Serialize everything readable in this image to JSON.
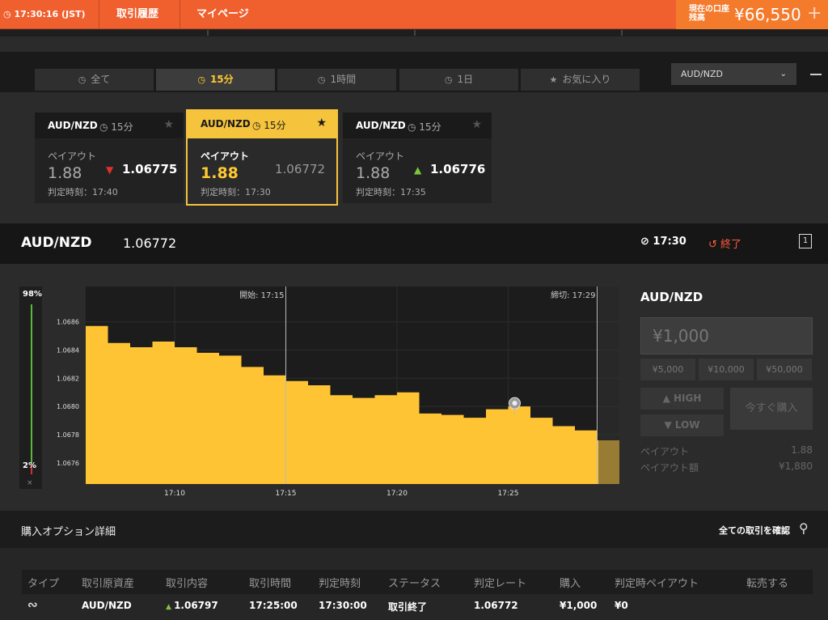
{
  "topbar": {
    "clock": "17:30:16 (JST)",
    "history_label": "取引履歴",
    "mypage_label": "マイページ",
    "balance_label": "現在の口座残高",
    "balance": "¥66,550",
    "plus": "+"
  },
  "tabs": [
    {
      "icon": "clock-icon",
      "label": "全て",
      "active": false
    },
    {
      "icon": "clock-icon",
      "label": "15分",
      "active": true
    },
    {
      "icon": "clock-icon",
      "label": "1時間",
      "active": false
    },
    {
      "icon": "clock-icon",
      "label": "1日",
      "active": false
    },
    {
      "icon": "star-icon",
      "label": "お気に入り",
      "active": false
    }
  ],
  "pair_select": {
    "value": "AUD/NZD"
  },
  "cards": [
    {
      "pair": "AUD/NZD",
      "duration": "15分",
      "payout_label": "ペイアウト",
      "payout": "1.88",
      "rate": "1.06775",
      "direction": "down",
      "judge": "判定時刻：17:40",
      "active": false
    },
    {
      "pair": "AUD/NZD",
      "duration": "15分",
      "payout_label": "ペイアウト",
      "payout": "1.88",
      "rate": "1.06772",
      "direction": "none",
      "judge": "判定時刻：17:30",
      "active": true
    },
    {
      "pair": "AUD/NZD",
      "duration": "15分",
      "payout_label": "ペイアウト",
      "payout": "1.88",
      "rate": "1.06776",
      "direction": "up",
      "judge": "判定時刻：17:35",
      "active": false
    }
  ],
  "infobar": {
    "pair": "AUD/NZD",
    "rate": "1.06772",
    "time": "17:30",
    "status": "終了"
  },
  "gauge": {
    "top": "98%",
    "bottom": "2%",
    "close": "×"
  },
  "chart_data": {
    "type": "area",
    "x_ticks": [
      "17:10",
      "17:15",
      "17:20",
      "17:25"
    ],
    "y_ticks": [
      "1.0686",
      "1.0684",
      "1.0682",
      "1.0680",
      "1.0678",
      "1.0676"
    ],
    "ylim": [
      1.06745,
      1.06885
    ],
    "start_label": "開始: 17:15",
    "end_label": "締切: 17:29",
    "series": [
      {
        "x": [
          "17:06",
          "17:07",
          "17:08",
          "17:09",
          "17:10",
          "17:11",
          "17:12",
          "17:13",
          "17:14",
          "17:15",
          "17:16",
          "17:17",
          "17:18",
          "17:19",
          "17:20",
          "17:21",
          "17:22",
          "17:23",
          "17:24",
          "17:25",
          "17:26",
          "17:27",
          "17:28",
          "17:29",
          "17:30"
        ],
        "values": [
          1.06857,
          1.06845,
          1.06842,
          1.06846,
          1.06842,
          1.06838,
          1.06836,
          1.06828,
          1.06822,
          1.06818,
          1.06815,
          1.06808,
          1.06806,
          1.06808,
          1.0681,
          1.06795,
          1.06794,
          1.06792,
          1.06798,
          1.068,
          1.06792,
          1.06786,
          1.06783,
          1.06776,
          1.06772
        ]
      }
    ]
  },
  "right_panel": {
    "pair": "AUD/NZD",
    "amount_placeholder": "¥1,000",
    "amount_buttons": [
      "¥5,000",
      "¥10,000",
      "¥50,000"
    ],
    "high_label": "HIGH",
    "low_label": "LOW",
    "buy_now_label": "今すぐ購入",
    "payout_label": "ペイアウト",
    "payout_value": "1.88",
    "payout_amount_label": "ペイアウト額",
    "payout_amount_value": "¥1,880"
  },
  "details": {
    "title": "購入オプション詳細",
    "all_label": "全ての取引を確認",
    "columns": [
      "タイプ",
      "取引原資産",
      "取引内容",
      "取引時間",
      "判定時刻",
      "ステータス",
      "判定レート",
      "購入",
      "判定時ペイアウト",
      "転売する"
    ],
    "rows": [
      {
        "type_icon": "highlow-icon",
        "asset": "AUD/NZD",
        "content": "1.06797",
        "trade_time": "17:25:00",
        "judge_time": "17:30:00",
        "status": "取引終了",
        "judge_rate": "1.06772",
        "purchase": "¥1,000",
        "payout": "¥0"
      }
    ]
  }
}
